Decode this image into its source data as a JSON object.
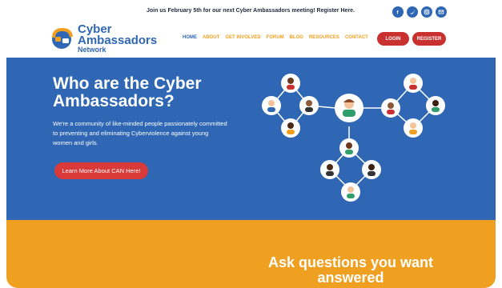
{
  "announcement": "Join us February 5th for our next Cyber Ambassadors meeting! Register Here.",
  "social_icons": [
    "facebook-icon",
    "twitter-icon",
    "instagram-icon",
    "email-icon"
  ],
  "logo": {
    "line1": "Cyber",
    "line2": "Ambassadors",
    "line3": "Network"
  },
  "nav": {
    "items": [
      "HOME",
      "ABOUT",
      "GET INVOLVED",
      "FORUM",
      "BLOG",
      "RESOURCES",
      "CONTACT"
    ],
    "login": "LOGIN",
    "register": "REGISTER"
  },
  "hero": {
    "title": "Who are the Cyber Ambassadors?",
    "description": "We're a community of like-minded people passionately committed to preventing and eliminating Cyberviolence against young women and girls.",
    "cta": "Learn More About CAN Here!"
  },
  "section2": {
    "title": "Ask questions you want answered"
  },
  "colors": {
    "brand_blue": "#2f67b4",
    "accent_orange": "#f0a020",
    "button_red": "#c8312f"
  }
}
